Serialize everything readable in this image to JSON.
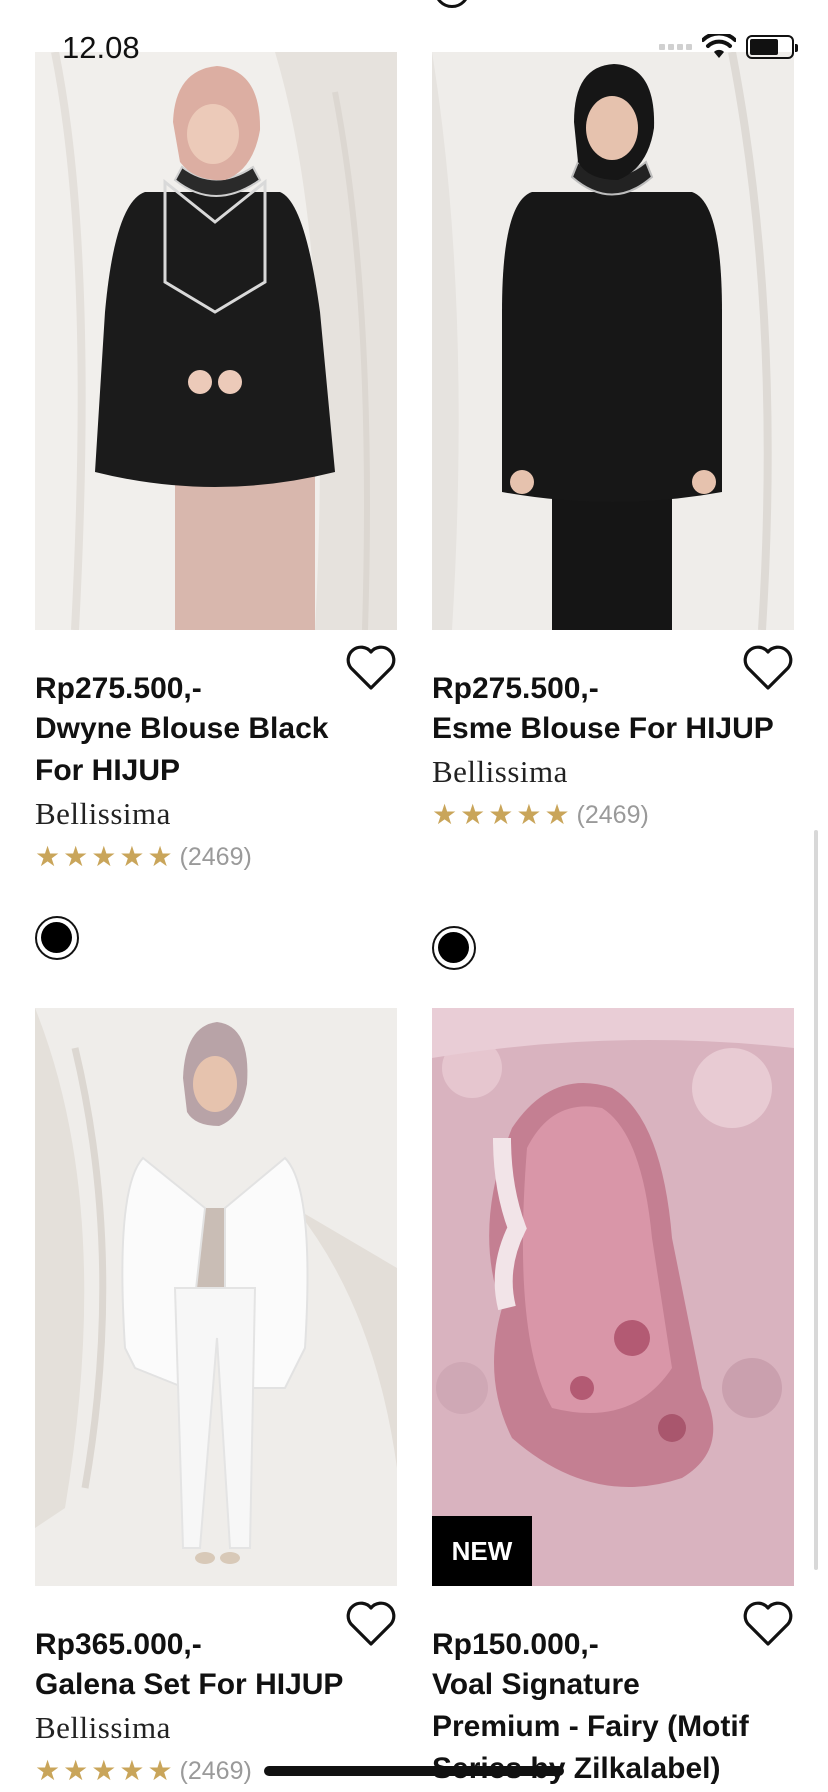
{
  "status_bar": {
    "time": "12.08"
  },
  "products": [
    {
      "price": "Rp275.500,-",
      "title_lines": [
        "Dwyne Blouse Black",
        "For HIJUP"
      ],
      "brand": "Bellissima",
      "rating_count": "(2469)",
      "rating": 5,
      "colors": [
        "#000000"
      ],
      "image": "woman in black blouse with white ruffle collar and pink hijab"
    },
    {
      "price": "Rp275.500,-",
      "title_lines": [
        "Esme Blouse For HIJUP"
      ],
      "brand": "Bellissima",
      "rating_count": "(2469)",
      "rating": 5,
      "colors": [
        "#000000"
      ],
      "image": "woman in black button blouse with black hijab"
    },
    {
      "price": "Rp365.000,-",
      "title_lines": [
        "Galena Set For HIJUP"
      ],
      "brand": "Bellissima",
      "rating_count": "(2469)",
      "rating": 5,
      "image": "woman in white outer and beige shirt set"
    },
    {
      "price": "Rp150.000,-",
      "title_lines": [
        "Voal Signature",
        "Premium - Fairy (Motif",
        "Series by Zilkalabel)"
      ],
      "badge": "NEW",
      "image": "pink floral voal hijab on mannequin"
    }
  ]
}
